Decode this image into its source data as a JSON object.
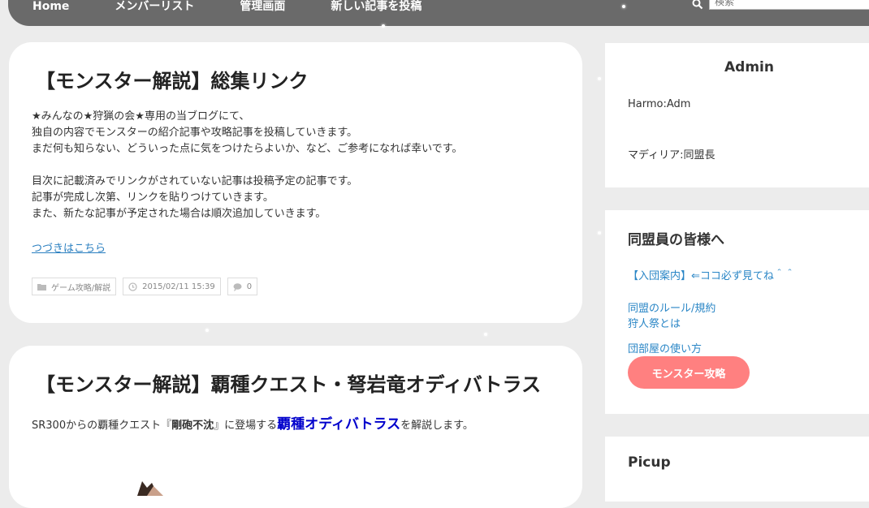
{
  "nav": {
    "home": "Home",
    "members": "メンバーリスト",
    "admin": "管理画面",
    "new_post": "新しい記事を投稿",
    "search_placeholder": "検索"
  },
  "articles": [
    {
      "title": "【モンスター解説】総集リンク",
      "paragraphs": [
        "★みんなの★狩猟の会★専用の当ブログにて、",
        "独自の内容でモンスターの紹介記事や攻略記事を投稿していきます。",
        "まだ何も知らない、どういった点に気をつけたらよいか、など、ご参考になれば幸いです。",
        "目次に記載済みでリンクがされていない記事は投稿予定の記事です。",
        "記事が完成し次第、リンクを貼りつけていきます。",
        "また、新たな記事が予定された場合は順次追加していきます。"
      ],
      "read_more": "つづきはこちら",
      "category": "ゲーム攻略/解説",
      "date": "2015/02/11 15:39",
      "comments": "0"
    },
    {
      "title": "【モンスター解説】覇種クエスト・弩岩竜オディバトラス",
      "text_before": "SR300からの覇種クエスト『",
      "text_bold": "剛砲不沈",
      "text_middle": "』に登場する",
      "text_link": "覇種オディバトラス",
      "text_after": "を解説します。"
    }
  ],
  "sidebar": {
    "admin_title": "Admin",
    "admin_line1": "Harmo:Adm",
    "admin_line2": "マディリア:同盟長",
    "members_heading": "同盟員の皆様へ",
    "links": [
      "【入団案内】⇐ココ必ず見てね＾＾",
      "同盟のルール/規約",
      "狩人祭とは",
      "団部屋の使い方"
    ],
    "monster_button": "モンスター攻略",
    "picup_heading": "Picup"
  },
  "colors": {
    "accent_button": "#ff8080",
    "link": "#2a86c6",
    "nav_bar": "#6a6a6a"
  }
}
